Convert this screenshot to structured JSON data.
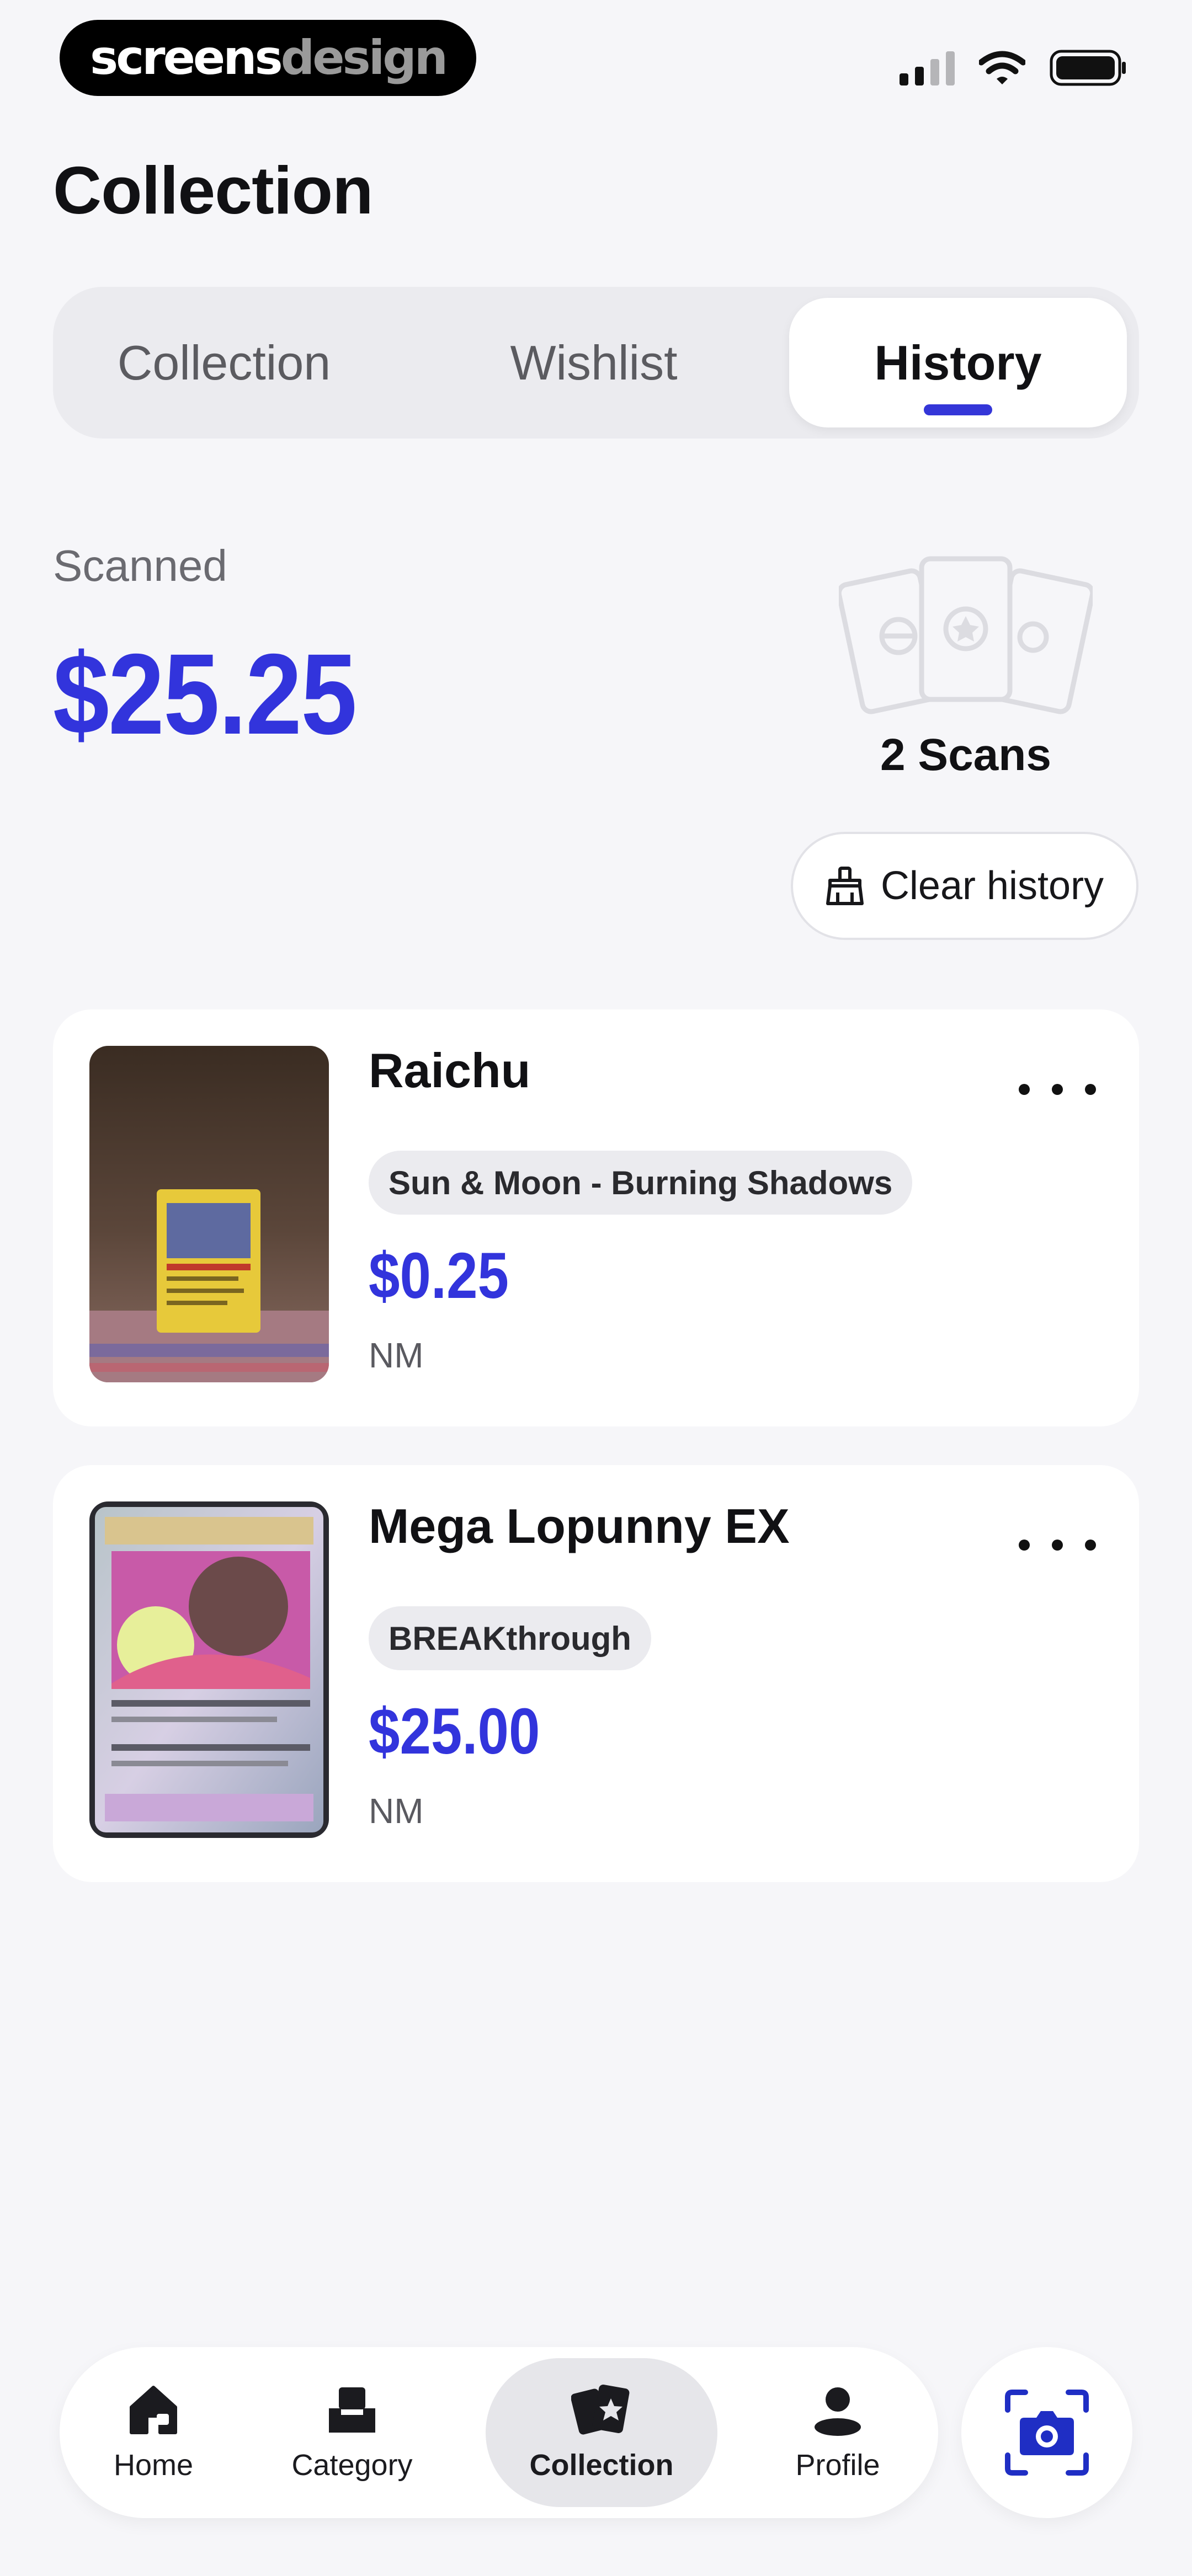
{
  "status_bar": {
    "brand_part1": "screens",
    "brand_part2": "design"
  },
  "page": {
    "title": "Collection"
  },
  "tabs": [
    {
      "label": "Collection",
      "active": false
    },
    {
      "label": "Wishlist",
      "active": false
    },
    {
      "label": "History",
      "active": true
    }
  ],
  "summary": {
    "label": "Scanned",
    "total": "$25.25",
    "scan_count": "2 Scans",
    "clear_label": "Clear history"
  },
  "history": [
    {
      "name": "Raichu",
      "set": "Sun & Moon - Burning Shadows",
      "price": "$0.25",
      "condition": "NM"
    },
    {
      "name": "Mega Lopunny EX",
      "set": "BREAKthrough",
      "price": "$25.00",
      "condition": "NM"
    }
  ],
  "bottom_nav": {
    "items": [
      {
        "label": "Home",
        "icon": "home-icon"
      },
      {
        "label": "Category",
        "icon": "category-icon"
      },
      {
        "label": "Collection",
        "icon": "cards-icon",
        "active": true
      },
      {
        "label": "Profile",
        "icon": "profile-icon"
      }
    ],
    "camera_icon": "camera-scan-icon"
  },
  "colors": {
    "accent": "#3234dc",
    "background": "#f6f6f9"
  }
}
